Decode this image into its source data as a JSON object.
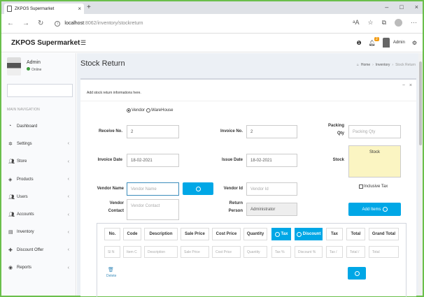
{
  "browser": {
    "tab_title": "ZKPOS Supermarket",
    "url_host": "localhost",
    "url_path": ":8062/inventory/stockreturn"
  },
  "header": {
    "brand": "ZKPOS Supermarket",
    "notification_count": "2",
    "user_label": "Admin"
  },
  "sidebar": {
    "user_name": "Admin",
    "user_status": "Online",
    "nav_header": "MAIN NAVIGATION",
    "items": [
      {
        "label": "Dashboard",
        "icon": "dashboard-icon"
      },
      {
        "label": "Settings",
        "icon": "gear-icon"
      },
      {
        "label": "Store",
        "icon": "users-icon"
      },
      {
        "label": "Products",
        "icon": "product-icon"
      },
      {
        "label": "Users",
        "icon": "users-icon"
      },
      {
        "label": "Accounts",
        "icon": "users-icon"
      },
      {
        "label": "Inventory",
        "icon": "inventory-icon"
      },
      {
        "label": "Discount Offer",
        "icon": "plus-icon"
      },
      {
        "label": "Reports",
        "icon": "reports-icon"
      }
    ]
  },
  "page": {
    "title": "Stock Return",
    "breadcrumb_home": "Home",
    "breadcrumb_section": "Inventory",
    "breadcrumb_current": "Stock Return",
    "box_title": "Add stock return informations here.",
    "radio_vendor": "Vendor",
    "radio_warehouse": "WareHouse"
  },
  "form": {
    "receive_no_label": "Receive No.",
    "receive_no_value": "2",
    "invoice_no_label": "Invoice No.",
    "invoice_no_value": "2",
    "packing_qty_label_1": "Packing",
    "packing_qty_label_2": "Qty",
    "packing_qty_placeholder": "Packing Qty",
    "invoice_date_label": "Invoice Date",
    "invoice_date_value": "18-02-2021",
    "issue_date_label": "Issue Date",
    "issue_date_value": "18-02-2021",
    "stock_label": "Stock",
    "stock_value": "Stock",
    "vendor_name_label": "Vendor Name",
    "vendor_name_placeholder": "Vendor Name",
    "vendor_id_label": "Vendor Id",
    "vendor_id_placeholder": "Vendor Id",
    "inclusive_tax_label": "Inclusive Tax",
    "vendor_contact_label_1": "Vendor",
    "vendor_contact_label_2": "Contact",
    "vendor_contact_placeholder": "Vendor Contact",
    "return_person_label_1": "Return",
    "return_person_label_2": "Person",
    "return_person_value": "Administrator",
    "add_items_label": "Add Items"
  },
  "table": {
    "headers": [
      "No.",
      "Code",
      "Description",
      "Sale Price",
      "Cost Price",
      "Quantity",
      "Tax",
      "Discount",
      "Tax",
      "Total",
      "Grand Total"
    ],
    "placeholders": [
      "Sl N",
      "Item C",
      "Description",
      "Sale Price",
      "Cost Price",
      "Quantity",
      "Tax %",
      "Discount %",
      "Tax /",
      "Total /",
      "Total"
    ],
    "delete_label": "Delete"
  }
}
